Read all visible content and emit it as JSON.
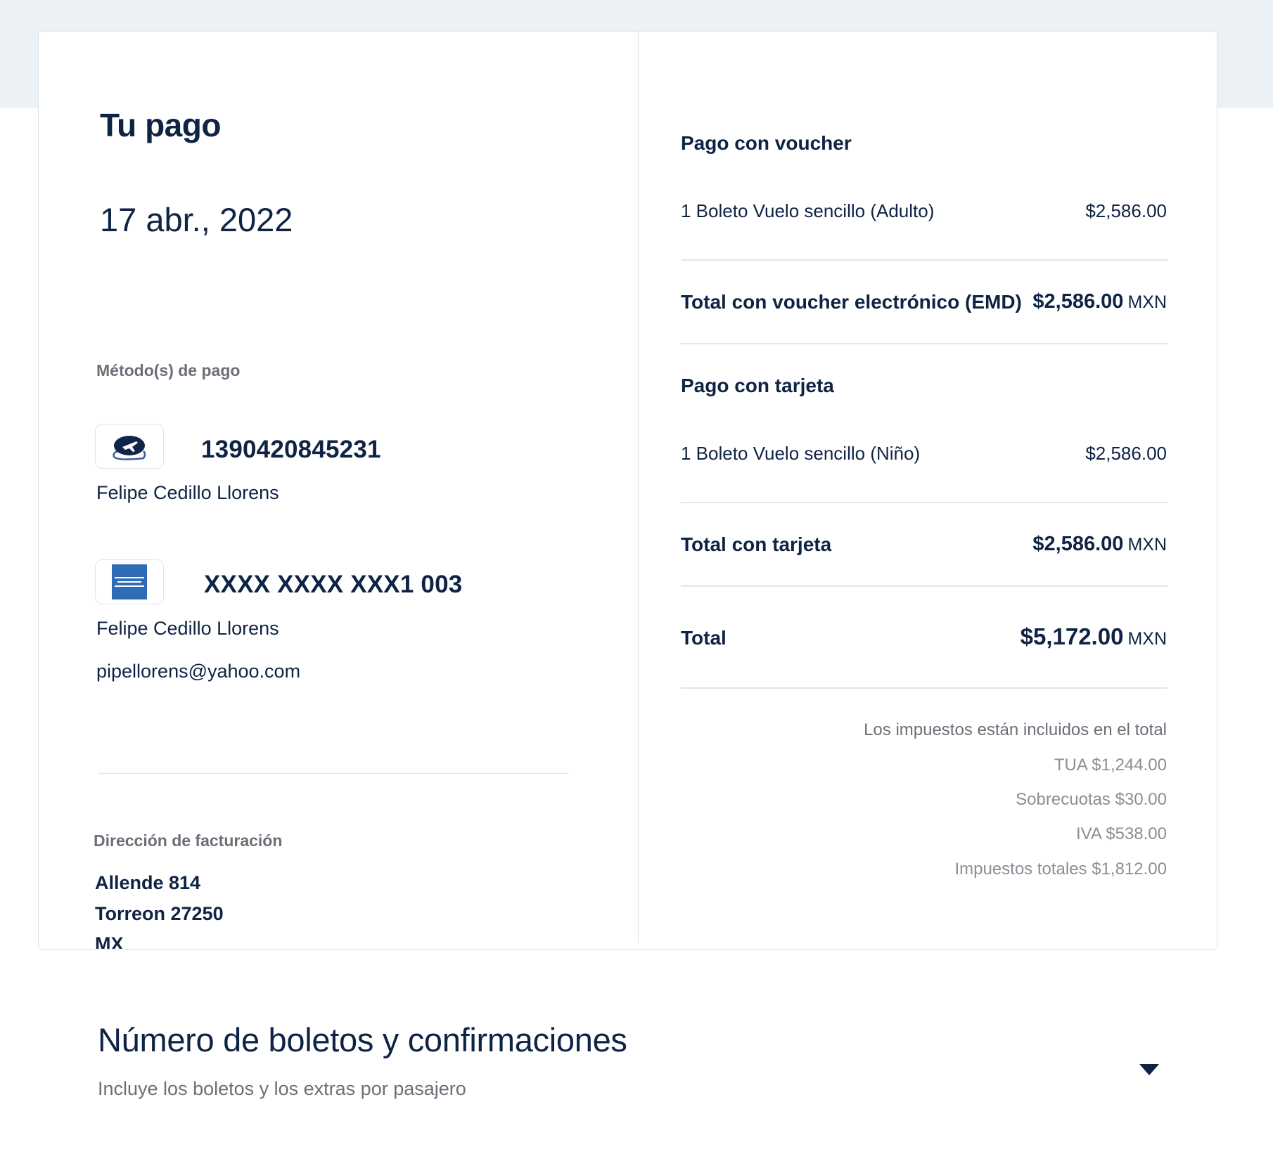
{
  "payment": {
    "title": "Tu pago",
    "date": "17 abr., 2022",
    "methods_label": "Método(s) de pago",
    "methods": [
      {
        "icon": "voucher-icon",
        "number": "1390420845231",
        "holder": "Felipe Cedillo Llorens"
      },
      {
        "icon": "american-express-icon",
        "number": "XXXX XXXX XXX1 003",
        "holder": "Felipe Cedillo Llorens",
        "email": "pipellorens@yahoo.com"
      }
    ],
    "billing_label": "Dirección de facturación",
    "billing_address": [
      "Allende 814",
      "Torreon 27250",
      "MX"
    ]
  },
  "summary": {
    "voucher_heading": "Pago con voucher",
    "voucher_item": {
      "label": "1 Boleto Vuelo sencillo (Adulto)",
      "amount": "$2,586.00"
    },
    "voucher_total": {
      "label": "Total con voucher electrónico (EMD)",
      "amount": "$2,586.00",
      "currency": "MXN"
    },
    "card_heading": "Pago con tarjeta",
    "card_item": {
      "label": "1 Boleto Vuelo sencillo (Niño)",
      "amount": "$2,586.00"
    },
    "card_total": {
      "label": "Total con tarjeta",
      "amount": "$2,586.00",
      "currency": "MXN"
    },
    "grand_total": {
      "label": "Total",
      "amount": "$5,172.00",
      "currency": "MXN"
    },
    "tax_note": "Los impuestos están incluidos en el total",
    "tax_lines": [
      "TUA $1,244.00",
      "Sobrecuotas $30.00",
      "IVA $538.00",
      "Impuestos totales $1,812.00"
    ]
  },
  "tickets_section": {
    "title": "Número de boletos y confirmaciones",
    "subtitle": "Incluye los boletos y los extras por pasajero"
  },
  "colors": {
    "text": "#0f2344",
    "band": "#ebf1f5",
    "amex": "#2e6db5"
  }
}
